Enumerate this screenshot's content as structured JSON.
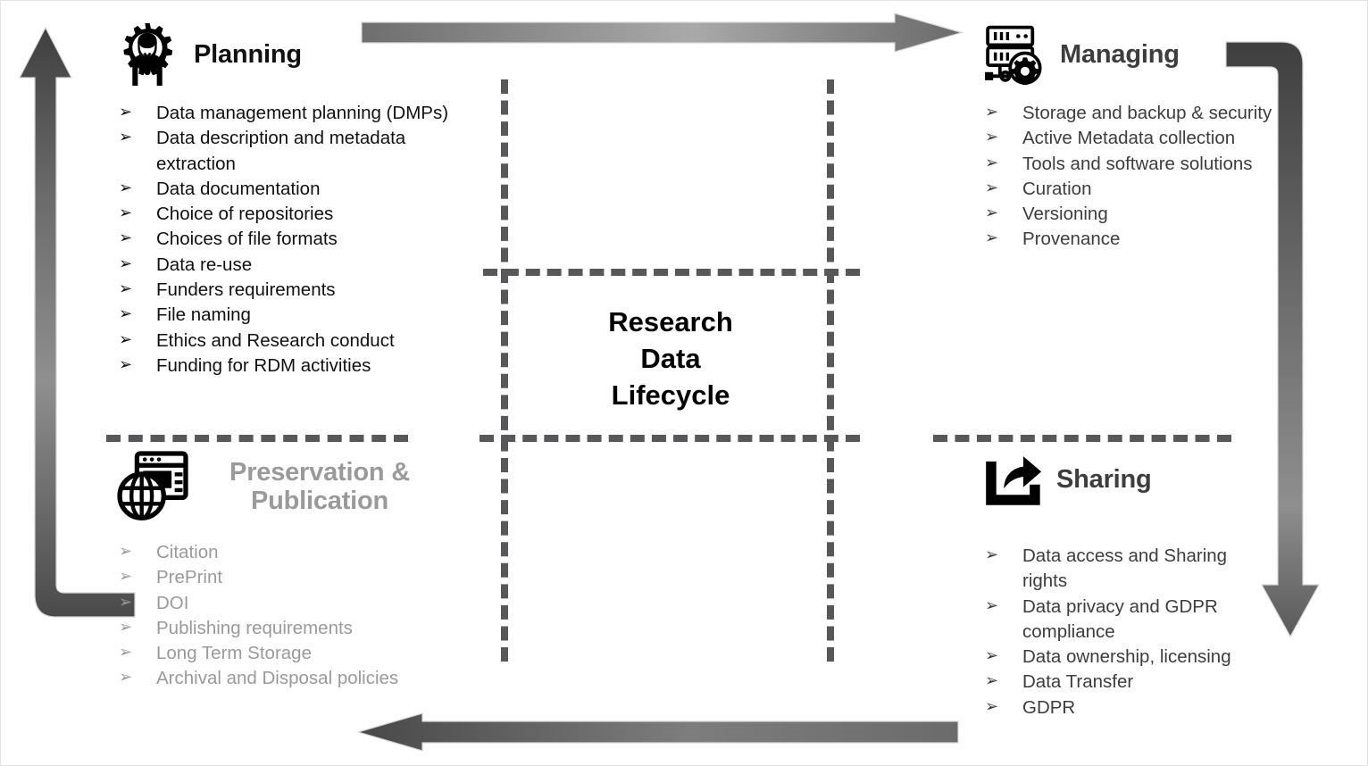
{
  "diagram": {
    "center_title_lines": [
      "Research",
      "Data",
      "Lifecycle"
    ],
    "bullet_marker": "➢",
    "colors": {
      "planning_text": "#111111",
      "managing_text": "#3d3d3d",
      "sharing_text": "#3d3d3d",
      "preservation_text": "#9a9a9a",
      "dashed_grid": "#58585b",
      "arrow_dark": "#4a4a4a",
      "arrow_light": "#a6a6a6",
      "page_background": "#ffffff"
    }
  },
  "quadrants": {
    "planning": {
      "title": "Planning",
      "icon": "gear-person-icon",
      "items": [
        "Data management planning (DMPs)",
        "Data description and metadata extraction",
        "Data documentation",
        "Choice of repositories",
        "Choices of file formats",
        "Data re-use",
        "Funders requirements",
        "File naming",
        "Ethics and Research conduct",
        "Funding for RDM activities"
      ]
    },
    "managing": {
      "title": "Managing",
      "icon": "server-gear-icon",
      "items": [
        "Storage and backup & security",
        "Active Metadata collection",
        "Tools and software solutions",
        "Curation",
        "Versioning",
        "Provenance"
      ]
    },
    "preservation": {
      "title": "Preservation & Publication",
      "icon": "globe-browser-icon",
      "items": [
        "Citation",
        "PrePrint",
        "DOI",
        "Publishing requirements",
        "Long Term Storage",
        "Archival and Disposal policies"
      ]
    },
    "sharing": {
      "title": "Sharing",
      "icon": "share-export-icon",
      "items": [
        "Data access and Sharing rights",
        "Data privacy and GDPR compliance",
        "Data ownership, licensing",
        "Data Transfer",
        "GDPR"
      ]
    }
  },
  "arrows": [
    {
      "name": "arrow-planning-to-managing",
      "direction": "right"
    },
    {
      "name": "arrow-managing-to-sharing",
      "direction": "down"
    },
    {
      "name": "arrow-sharing-to-preservation",
      "direction": "left"
    },
    {
      "name": "arrow-preservation-to-planning",
      "direction": "up"
    }
  ]
}
